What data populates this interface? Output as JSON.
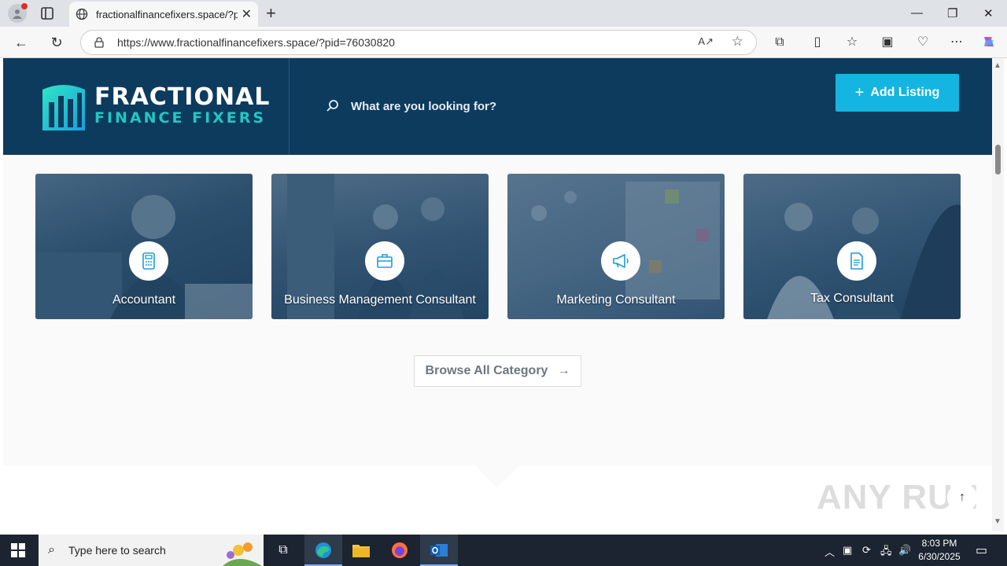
{
  "browser": {
    "tab_title": "fractionalfinancefixers.space/?pid=",
    "url": "https://www.fractionalfinancefixers.space/?pid=76030820"
  },
  "header": {
    "logo_line1": "FRACTIONAL",
    "logo_line2": "FINANCE FIXERS",
    "search_placeholder": "What are you looking for?",
    "add_listing_label": "Add Listing"
  },
  "categories": [
    {
      "label": "Accountant",
      "icon": "calculator-icon"
    },
    {
      "label": "Business Management Consultant",
      "icon": "briefcase-icon"
    },
    {
      "label": "Marketing Consultant",
      "icon": "megaphone-icon"
    },
    {
      "label": "Tax Consultant",
      "icon": "document-icon"
    }
  ],
  "browse_label": "Browse All Category",
  "watermark": "ANY RUN",
  "taskbar": {
    "search_placeholder": "Type here to search",
    "time": "8:03 PM",
    "date": "6/30/2025"
  },
  "colors": {
    "header_bg": "#0d3b5e",
    "accent": "#14b5e0",
    "logo_teal": "#22c7c2"
  }
}
